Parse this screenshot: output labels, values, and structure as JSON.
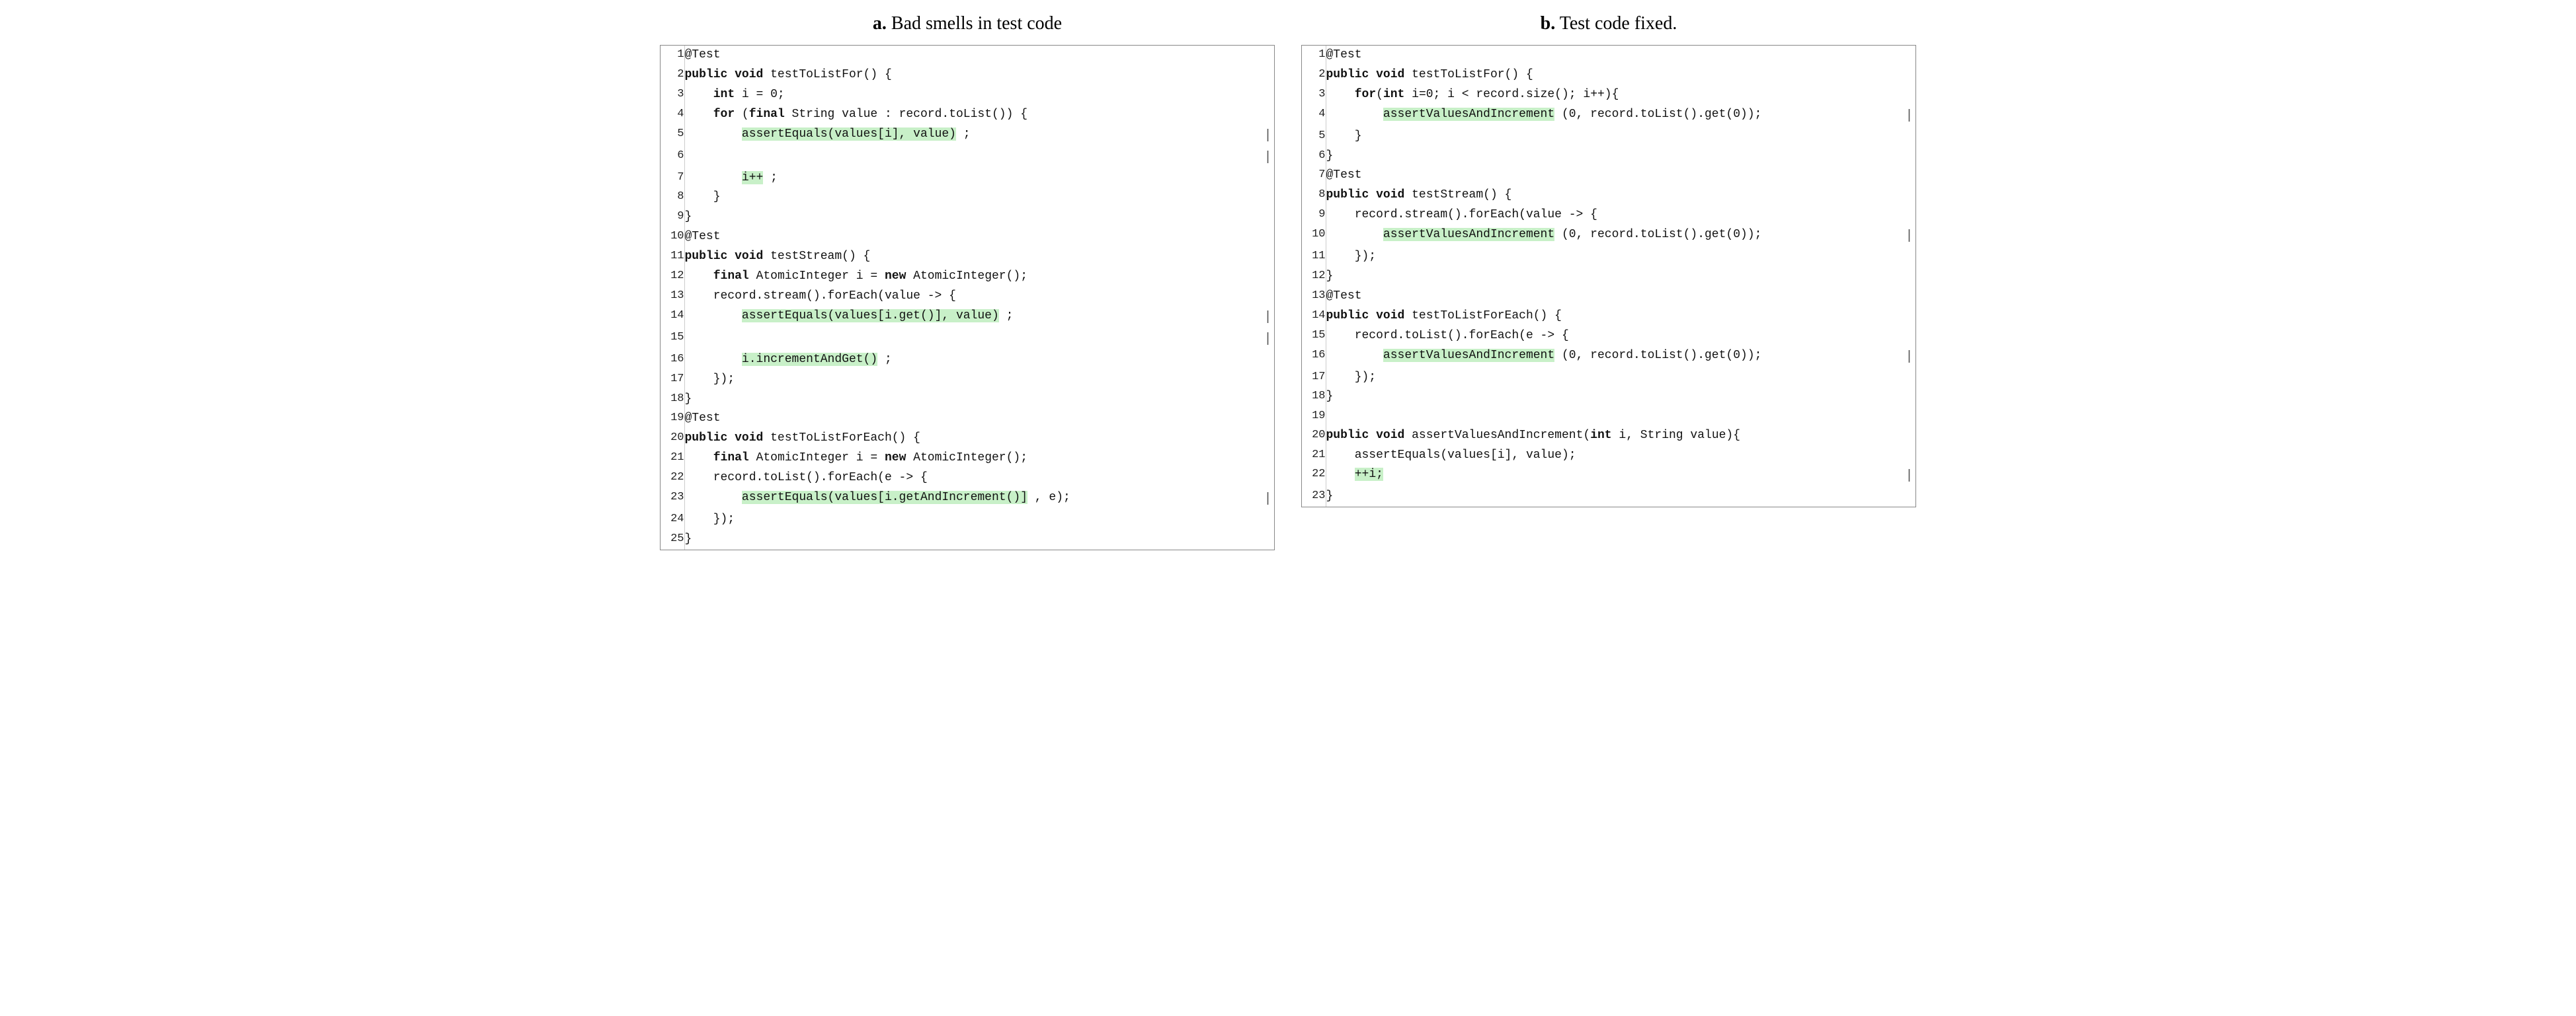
{
  "panelA": {
    "title_prefix": "a.",
    "title_text": " Bad smells in test code",
    "lines": [
      {
        "num": 1,
        "parts": [
          {
            "t": "@Test",
            "cls": ""
          }
        ]
      },
      {
        "num": 2,
        "parts": [
          {
            "t": "public void testToListFor() {",
            "cls": "kw",
            "kw": "public void ",
            "rest": "testToListFor() {"
          }
        ]
      },
      {
        "num": 3,
        "parts": [
          {
            "t": "    int i = 0;",
            "cls": "",
            "indent": "    ",
            "kw": "int",
            "rest": " i = 0;"
          }
        ]
      },
      {
        "num": 4,
        "parts": [
          {
            "t": "    for (final String value : record.toList()) {",
            "cls": "",
            "indent": "    ",
            "kw": "for",
            "rest": " (",
            "kw2": "final",
            "rest2": " String value : record.toList()) {"
          }
        ]
      },
      {
        "num": 5,
        "bar": true,
        "parts": [
          {
            "t": "        assertEquals(values[i], value) ;",
            "cls": "highlight",
            "indent": "        ",
            "code": "assertEquals(values[i], value)",
            "rest": " ;"
          }
        ]
      },
      {
        "num": 6,
        "bar": true,
        "parts": [
          {
            "t": "",
            "cls": ""
          }
        ]
      },
      {
        "num": 7,
        "bar": false,
        "parts": [
          {
            "t": "        i++ ;",
            "cls": "highlight2",
            "indent": "        ",
            "code": "i++",
            "rest": " ;"
          }
        ]
      },
      {
        "num": 8,
        "parts": [
          {
            "t": "    }",
            "cls": ""
          }
        ]
      },
      {
        "num": 9,
        "parts": [
          {
            "t": "}",
            "cls": ""
          }
        ]
      },
      {
        "num": 10,
        "parts": [
          {
            "t": "@Test",
            "cls": ""
          }
        ]
      },
      {
        "num": 11,
        "parts": [
          {
            "t": "public void testStream() {",
            "cls": "kw2line"
          }
        ]
      },
      {
        "num": 12,
        "parts": [
          {
            "t": "    final AtomicInteger i = new AtomicInteger();",
            "cls": "kw2line"
          }
        ]
      },
      {
        "num": 13,
        "parts": [
          {
            "t": "    record.stream().forEach(value -> {",
            "cls": ""
          }
        ]
      },
      {
        "num": 14,
        "bar": true,
        "parts": [
          {
            "t": "        assertEquals(values[i.get()], value) ;",
            "cls": "highlight",
            "indent": "        ",
            "code": "assertEquals(values[i.get()], value)",
            "rest": " ;"
          }
        ]
      },
      {
        "num": 15,
        "bar": true,
        "parts": [
          {
            "t": "",
            "cls": ""
          }
        ]
      },
      {
        "num": 16,
        "bar": false,
        "parts": [
          {
            "t": "        i.incrementAndGet() ;",
            "cls": "highlight2",
            "indent": "        ",
            "code": "i.incrementAndGet()",
            "rest": " ;"
          }
        ]
      },
      {
        "num": 17,
        "parts": [
          {
            "t": "    });",
            "cls": ""
          }
        ]
      },
      {
        "num": 18,
        "parts": [
          {
            "t": "}",
            "cls": ""
          }
        ]
      },
      {
        "num": 19,
        "parts": [
          {
            "t": "@Test",
            "cls": ""
          }
        ]
      },
      {
        "num": 20,
        "parts": [
          {
            "t": "public void testToListForEach() {",
            "cls": "kw2line"
          }
        ]
      },
      {
        "num": 21,
        "parts": [
          {
            "t": "    final AtomicInteger i = new AtomicInteger();",
            "cls": "kw2line"
          }
        ]
      },
      {
        "num": 22,
        "parts": [
          {
            "t": "    record.toList().forEach(e -> {",
            "cls": ""
          }
        ]
      },
      {
        "num": 23,
        "bar": true,
        "parts": [
          {
            "t": "        assertEquals(values[i.getAndIncrement()] , e);",
            "cls": "highlight",
            "indent": "        ",
            "code": "assertEquals(values[i.getAndIncrement()]",
            "rest": " , e);"
          }
        ]
      },
      {
        "num": 24,
        "parts": [
          {
            "t": "    });",
            "cls": ""
          }
        ]
      },
      {
        "num": 25,
        "parts": [
          {
            "t": "}",
            "cls": ""
          }
        ]
      }
    ]
  },
  "panelB": {
    "title_prefix": "b.",
    "title_text": " Test code fixed.",
    "lines": [
      {
        "num": 1,
        "parts": [
          {
            "t": "@Test",
            "cls": ""
          }
        ]
      },
      {
        "num": 2,
        "parts": [
          {
            "t": "public void testToListFor() {",
            "cls": "kw2line"
          }
        ]
      },
      {
        "num": 3,
        "parts": [
          {
            "t": "    for(int i=0; i < record.size(); i++){",
            "cls": "",
            "indent": "    ",
            "kw": "for",
            "rest": "(",
            "kw2": "int",
            "rest2": " i=0; i < record.size(); i++){"
          }
        ]
      },
      {
        "num": 4,
        "bar": true,
        "parts": [
          {
            "t": "        assertValuesAndIncrement (0, record.toList().get(0));",
            "cls": "highlight",
            "indent": "        ",
            "code": "assertValuesAndIncrement",
            "rest": " (0, record.toList().get(0));"
          }
        ]
      },
      {
        "num": 5,
        "parts": [
          {
            "t": "    }",
            "cls": ""
          }
        ]
      },
      {
        "num": 6,
        "parts": [
          {
            "t": "}",
            "cls": ""
          }
        ]
      },
      {
        "num": 7,
        "parts": [
          {
            "t": "@Test",
            "cls": ""
          }
        ]
      },
      {
        "num": 8,
        "parts": [
          {
            "t": "public void testStream() {",
            "cls": "kw2line"
          }
        ]
      },
      {
        "num": 9,
        "parts": [
          {
            "t": "    record.stream().forEach(value -> {",
            "cls": ""
          }
        ]
      },
      {
        "num": 10,
        "bar": true,
        "parts": [
          {
            "t": "        assertValuesAndIncrement (0, record.toList().get(0));",
            "cls": "highlight",
            "indent": "        ",
            "code": "assertValuesAndIncrement",
            "rest": " (0, record.toList().get(0));"
          }
        ]
      },
      {
        "num": 11,
        "parts": [
          {
            "t": "    });",
            "cls": ""
          }
        ]
      },
      {
        "num": 12,
        "parts": [
          {
            "t": "}",
            "cls": ""
          }
        ]
      },
      {
        "num": 13,
        "parts": [
          {
            "t": "@Test",
            "cls": ""
          }
        ]
      },
      {
        "num": 14,
        "parts": [
          {
            "t": "public void testToListForEach() {",
            "cls": "kw2line"
          }
        ]
      },
      {
        "num": 15,
        "parts": [
          {
            "t": "    record.toList().forEach(e -> {",
            "cls": ""
          }
        ]
      },
      {
        "num": 16,
        "bar": true,
        "parts": [
          {
            "t": "        assertValuesAndIncrement (0, record.toList().get(0));",
            "cls": "highlight",
            "indent": "        ",
            "code": "assertValuesAndIncrement",
            "rest": " (0, record.toList().get(0));"
          }
        ]
      },
      {
        "num": 17,
        "parts": [
          {
            "t": "    });",
            "cls": ""
          }
        ]
      },
      {
        "num": 18,
        "parts": [
          {
            "t": "}",
            "cls": ""
          }
        ]
      },
      {
        "num": 19,
        "parts": [
          {
            "t": "",
            "cls": ""
          }
        ]
      },
      {
        "num": 20,
        "parts": [
          {
            "t": "public void assertValuesAndIncrement(int i, String value){",
            "cls": "kw2line",
            "kw": "public void ",
            "rest": "assertValuesAndIncrement(",
            "kw2": "int",
            "rest2": " i, String value){"
          }
        ]
      },
      {
        "num": 21,
        "parts": [
          {
            "t": "    assertEquals(values[i], value);",
            "cls": ""
          }
        ]
      },
      {
        "num": 22,
        "bar": true,
        "parts": [
          {
            "t": "    ++i;",
            "cls": "highlight",
            "indent": "    ",
            "code": "++i;",
            "rest": ""
          }
        ]
      },
      {
        "num": 23,
        "parts": [
          {
            "t": "}",
            "cls": ""
          }
        ]
      }
    ]
  }
}
